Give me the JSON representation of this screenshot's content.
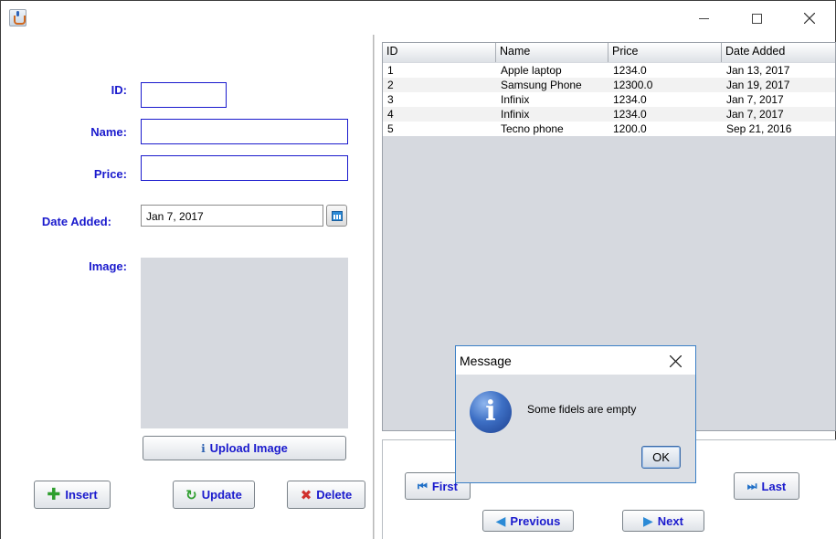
{
  "window": {
    "icon": "java-cup-icon",
    "controls": [
      "minimize-icon",
      "maximize-icon",
      "close-icon"
    ]
  },
  "form": {
    "id_label": "ID:",
    "name_label": "Name:",
    "price_label": "Price:",
    "date_label": "Date Added:",
    "image_label": "Image:",
    "id_value": "",
    "name_value": "",
    "price_value": "",
    "date_value": "Jan 7, 2017",
    "upload_label": "Upload Image",
    "insert_label": "Insert",
    "update_label": "Update",
    "delete_label": "Delete"
  },
  "table": {
    "columns": [
      "ID",
      "Name",
      "Price",
      "Date Added"
    ],
    "rows": [
      [
        "1",
        "Apple laptop",
        "1234.0",
        "Jan 13, 2017"
      ],
      [
        "2",
        "Samsung Phone",
        "12300.0",
        "Jan 19, 2017"
      ],
      [
        "3",
        "Infinix",
        "1234.0",
        "Jan 7, 2017"
      ],
      [
        "4",
        "Infinix",
        "1234.0",
        "Jan 7, 2017"
      ],
      [
        "5",
        "Tecno phone",
        "1200.0",
        "Sep 21, 2016"
      ]
    ]
  },
  "nav": {
    "first_label": "First",
    "last_label": "Last",
    "previous_label": "Previous",
    "next_label": "Next"
  },
  "dialog": {
    "title": "Message",
    "message": "Some fidels are empty",
    "ok_label": "OK",
    "icon": "info-icon"
  },
  "colors": {
    "label_blue": "#1a1acd",
    "panel_gray": "#d6d9df",
    "row_alt": "#f2f2f2"
  }
}
